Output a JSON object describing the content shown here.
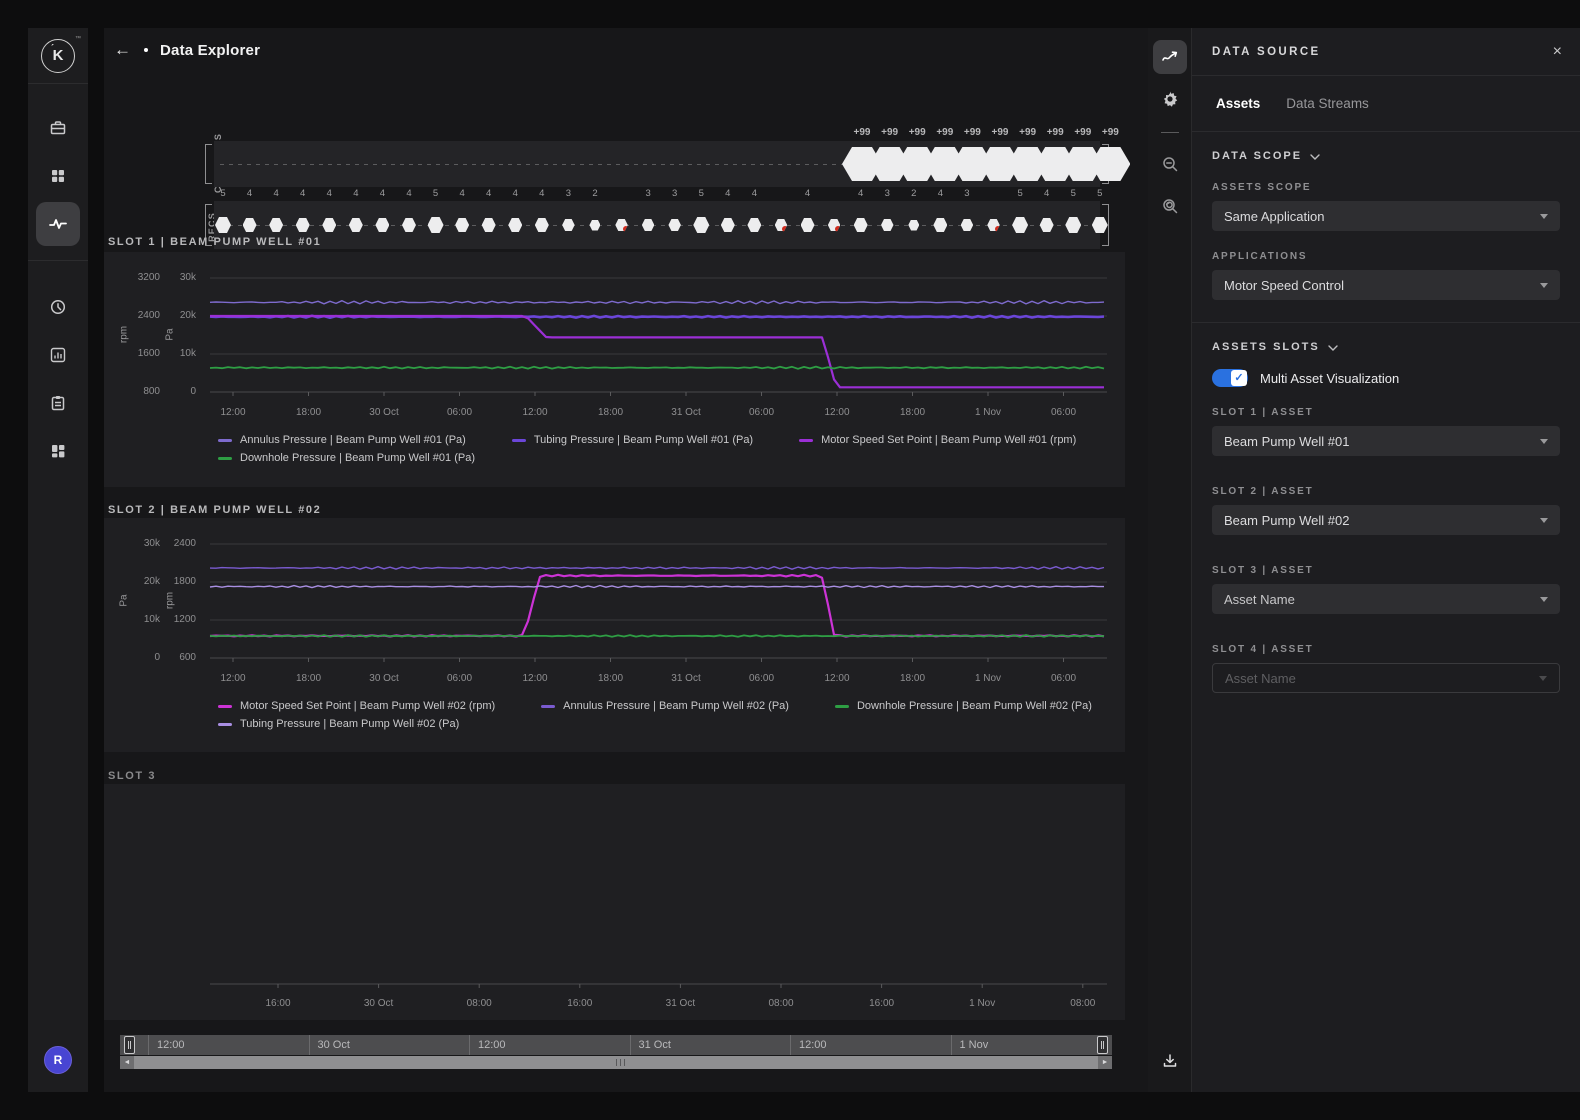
{
  "app": {
    "logo_letter": "K",
    "logo_tick": "´",
    "trademark": "™"
  },
  "header": {
    "back_icon": "←",
    "title": "Data Explorer"
  },
  "sidebar": {
    "icons": [
      "toolbox-icon",
      "grid-icon",
      "pulse-icon",
      "history-clock-icon",
      "bar-chart-icon",
      "clipboard-icon",
      "dashboard-tiles-icon"
    ],
    "active_icon": "pulse-icon",
    "avatar_initial": "R"
  },
  "timeline": {
    "lanes": [
      {
        "label": "CONTROLS"
      },
      {
        "label": "RECS"
      }
    ],
    "controls_badges": [
      "+99",
      "+99",
      "+99",
      "+99",
      "+99",
      "+99",
      "+99",
      "+99",
      "+99",
      "+99"
    ],
    "recs_dots": [
      {
        "n": "5",
        "red": false
      },
      {
        "n": "4",
        "red": false
      },
      {
        "n": "4",
        "red": false
      },
      {
        "n": "4",
        "red": false
      },
      {
        "n": "4",
        "red": false
      },
      {
        "n": "4",
        "red": false
      },
      {
        "n": "4",
        "red": false
      },
      {
        "n": "4",
        "red": false
      },
      {
        "n": "5",
        "red": false
      },
      {
        "n": "4",
        "red": false
      },
      {
        "n": "4",
        "red": false
      },
      {
        "n": "4",
        "red": false
      },
      {
        "n": "4",
        "red": false
      },
      {
        "n": "3",
        "red": false
      },
      {
        "n": "2",
        "red": false
      },
      {
        "n": "",
        "red": true
      },
      {
        "n": "3",
        "red": false
      },
      {
        "n": "3",
        "red": false
      },
      {
        "n": "5",
        "red": false
      },
      {
        "n": "4",
        "red": false
      },
      {
        "n": "4",
        "red": false
      },
      {
        "n": "",
        "red": true
      },
      {
        "n": "4",
        "red": false
      },
      {
        "n": "",
        "red": true
      },
      {
        "n": "4",
        "red": false
      },
      {
        "n": "3",
        "red": false
      },
      {
        "n": "2",
        "red": false
      },
      {
        "n": "4",
        "red": false
      },
      {
        "n": "3",
        "red": false
      },
      {
        "n": "",
        "red": true
      },
      {
        "n": "5",
        "red": false
      },
      {
        "n": "4",
        "red": false
      },
      {
        "n": "5",
        "red": false
      },
      {
        "n": "5",
        "red": false
      }
    ]
  },
  "chart_data": [
    {
      "type": "line",
      "title": "SLOT 1 | BEAM PUMP WELL #01",
      "x_ticks": [
        "12:00",
        "18:00",
        "30 Oct",
        "06:00",
        "12:00",
        "18:00",
        "31 Oct",
        "06:00",
        "12:00",
        "18:00",
        "1 Nov",
        "06:00"
      ],
      "axes": [
        {
          "title": "rpm",
          "min": 800,
          "max": 3200,
          "ticks": [
            "3200",
            "2400",
            "1600",
            "800"
          ]
        },
        {
          "title": "Pa",
          "min": 0,
          "max": 30000,
          "ticks": [
            "30k",
            "20k",
            "10k",
            "0"
          ]
        }
      ],
      "series": [
        {
          "name": "Annulus Pressure | Beam Pump Well #01 (Pa)",
          "color": "#7e6bce",
          "axis": 1,
          "width": 1.4,
          "noise": 450,
          "points": [
            [
              0,
              23600
            ],
            [
              1,
              23600
            ]
          ]
        },
        {
          "name": "Tubing Pressure | Beam Pump Well #01 (Pa)",
          "color": "#6b46d9",
          "axis": 1,
          "width": 2.6,
          "noise": 250,
          "points": [
            [
              0,
              19800
            ],
            [
              1,
              19800
            ]
          ]
        },
        {
          "name": "Motor Speed Set Point | Beam Pump Well #01 (rpm)",
          "color": "#9b2fd6",
          "axis": 0,
          "width": 2.2,
          "noise": 0,
          "points": [
            [
              0,
              2400
            ],
            [
              0.352,
              2400
            ],
            [
              0.375,
              1950
            ],
            [
              0.683,
              1950
            ],
            [
              0.698,
              900
            ],
            [
              1,
              900
            ]
          ]
        },
        {
          "name": "Downhole Pressure | Beam Pump Well #01 (Pa)",
          "color": "#2e9e44",
          "axis": 1,
          "width": 1.8,
          "noise": 300,
          "points": [
            [
              0,
              6400
            ],
            [
              1,
              6400
            ]
          ]
        }
      ],
      "grid": true,
      "legend_position": "bottom"
    },
    {
      "type": "line",
      "title": "SLOT 2 | BEAM PUMP WELL #02",
      "x_ticks": [
        "12:00",
        "18:00",
        "30 Oct",
        "06:00",
        "12:00",
        "18:00",
        "31 Oct",
        "06:00",
        "12:00",
        "18:00",
        "1 Nov",
        "06:00"
      ],
      "axes": [
        {
          "title": "Pa",
          "min": 0,
          "max": 30000,
          "ticks": [
            "30k",
            "20k",
            "10k",
            "0"
          ]
        },
        {
          "title": "rpm",
          "min": 600,
          "max": 2400,
          "ticks": [
            "2400",
            "1800",
            "1200",
            "600"
          ]
        }
      ],
      "series": [
        {
          "name": "Motor Speed Set Point | Beam Pump Well #02 (rpm)",
          "color": "#cc33d6",
          "axis": 1,
          "width": 2.2,
          "noise": 15,
          "points": [
            [
              0,
              950
            ],
            [
              0.35,
              950
            ],
            [
              0.368,
              1900
            ],
            [
              0.682,
              1900
            ],
            [
              0.696,
              950
            ],
            [
              1,
              950
            ]
          ]
        },
        {
          "name": "Annulus Pressure | Beam Pump Well #02 (Pa)",
          "color": "#7a5bd0",
          "axis": 0,
          "width": 1.4,
          "noise": 350,
          "points": [
            [
              0,
              23700
            ],
            [
              1,
              23700
            ]
          ]
        },
        {
          "name": "Downhole Pressure | Beam Pump Well #02 (Pa)",
          "color": "#2e9e44",
          "axis": 0,
          "width": 1.8,
          "noise": 250,
          "points": [
            [
              0,
              5800
            ],
            [
              1,
              5800
            ]
          ]
        },
        {
          "name": "Tubing Pressure | Beam Pump Well #02 (Pa)",
          "color": "#a98fe3",
          "axis": 0,
          "width": 1.4,
          "noise": 300,
          "points": [
            [
              0,
              18800
            ],
            [
              1,
              18800
            ]
          ]
        }
      ],
      "grid": true,
      "legend_position": "bottom"
    },
    {
      "type": "line",
      "title": "SLOT 3",
      "x_ticks": [
        "16:00",
        "30 Oct",
        "08:00",
        "16:00",
        "31 Oct",
        "08:00",
        "16:00",
        "1 Nov",
        "08:00"
      ],
      "axes": [],
      "series": [],
      "grid": false,
      "legend_position": "none"
    }
  ],
  "scrubber": {
    "labels": [
      "12:00",
      "30 Oct",
      "12:00",
      "31 Oct",
      "12:00",
      "1 Nov"
    ]
  },
  "tool_rail": {
    "icons": [
      "trend-icon",
      "settings-gear-icon",
      "zoom-out-icon",
      "zoom-history-icon"
    ],
    "download_icon": "download-icon"
  },
  "data_source": {
    "title": "DATA SOURCE",
    "close_glyph": "×",
    "tabs": [
      {
        "label": "Assets",
        "active": true
      },
      {
        "label": "Data Streams",
        "active": false
      }
    ],
    "data_scope": {
      "heading": "DATA SCOPE",
      "assets_scope_label": "ASSETS SCOPE",
      "assets_scope_value": "Same Application",
      "applications_label": "APPLICATIONS",
      "applications_value": "Motor Speed Control"
    },
    "assets_slots": {
      "heading": "ASSETS SLOTS",
      "toggle_label": "Multi Asset Visualization",
      "toggle_on": true,
      "toggle_check": "✓",
      "slots": [
        {
          "label": "SLOT 1 | ASSET",
          "value": "Beam Pump Well #01",
          "state": "filled"
        },
        {
          "label": "SLOT 2 | ASSET",
          "value": "Beam Pump Well #02",
          "state": "filled"
        },
        {
          "label": "SLOT 3 | ASSET",
          "value": "Asset Name",
          "state": "placeholder"
        },
        {
          "label": "SLOT 4 | ASSET",
          "value": "Asset Name",
          "state": "disabled"
        }
      ]
    }
  },
  "colors": {
    "accent_blue": "#2A71E0",
    "alert_red": "#CF2B1E",
    "hex_white": "#EDEDEE"
  }
}
